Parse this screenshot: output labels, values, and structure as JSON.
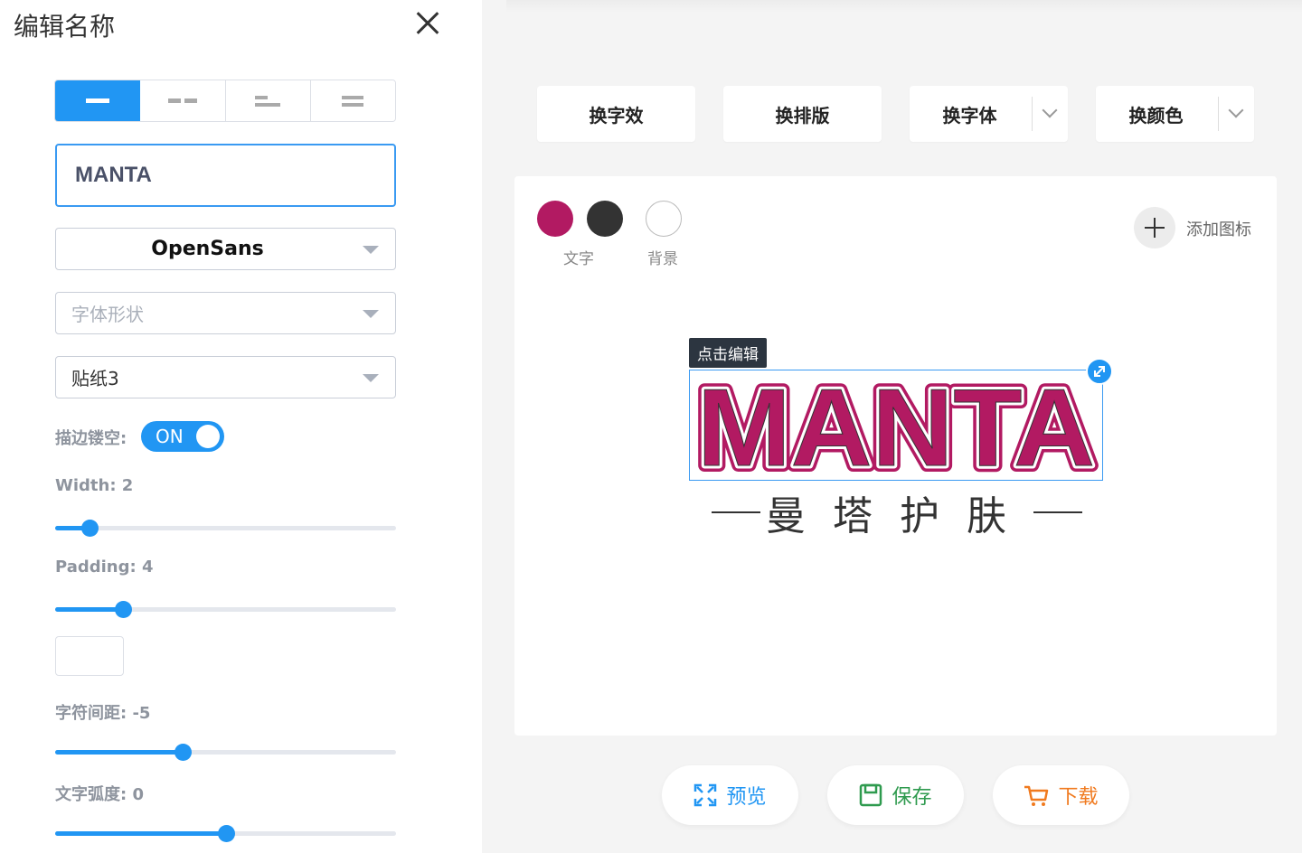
{
  "panel": {
    "title": "编辑名称",
    "name_value": "MANTA",
    "font_select": "OpenSans",
    "font_shape_placeholder": "字体形状",
    "effect_select": "贴纸3",
    "stroke_label": "描边镂空:",
    "stroke_toggle": "ON",
    "width_label": "Width:  2",
    "width_value": 2,
    "width_slider_fraction": 0.1,
    "padding_label": "Padding:  4",
    "padding_value": 4,
    "padding_slider_fraction": 0.2,
    "spacing_label": "字符间距:  -5",
    "spacing_value": -5,
    "spacing_slider_fraction": 0.375,
    "arc_label": "文字弧度:  0",
    "arc_value": 0,
    "arc_slider_fraction": 0.5
  },
  "toolbar": {
    "effect": "换字效",
    "layout": "换排版",
    "font": "换字体",
    "color": "换颜色"
  },
  "canvas": {
    "swatches": {
      "text_color": "#b21a62",
      "second_color": "#333333",
      "bg_color": "#ffffff",
      "text_label": "文字",
      "bg_label": "背景"
    },
    "add_icon": "添加图标",
    "edit_tip": "点击编辑",
    "logo_text": "MANTA",
    "slogan": "曼塔护肤"
  },
  "actions": {
    "preview": "预览",
    "save": "保存",
    "download": "下载"
  },
  "colors": {
    "accent": "#2196f3",
    "preview": "#2196f3",
    "save": "#2e9a4e",
    "download": "#f07a1f"
  }
}
